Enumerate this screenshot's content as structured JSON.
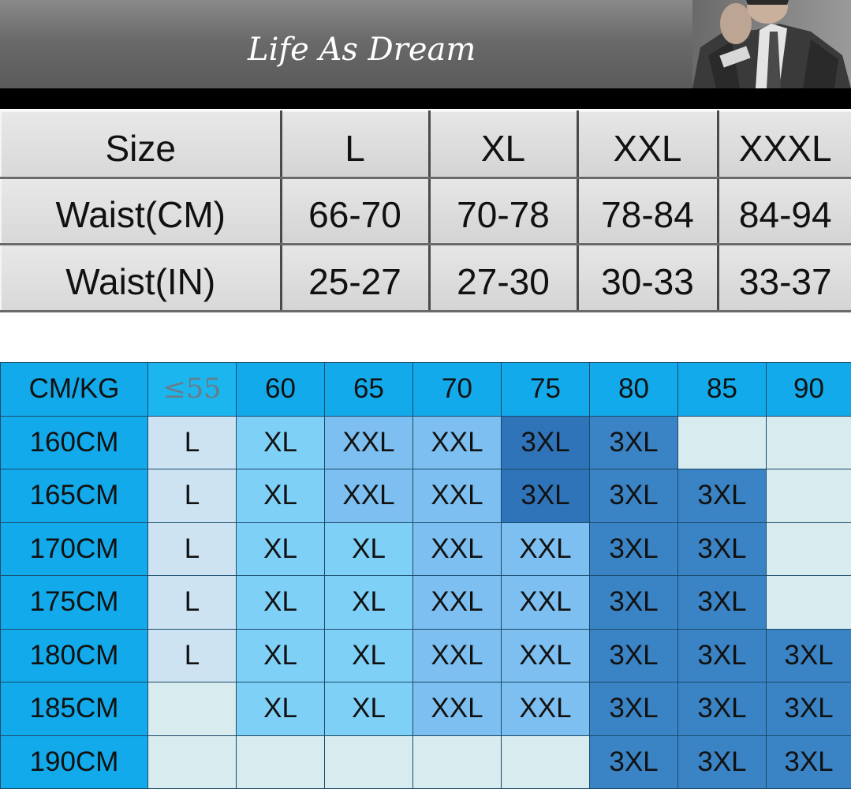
{
  "header": {
    "brand": "Life As Dream",
    "photo_icon": "model-portrait-photo"
  },
  "size_table": {
    "columns": [
      "Size",
      "L",
      "XL",
      "XXL",
      "XXXL"
    ],
    "rows": [
      {
        "label": "Waist(CM)",
        "values": [
          "66-70",
          "70-78",
          "78-84",
          "84-94"
        ]
      },
      {
        "label": "Waist(IN)",
        "values": [
          "25-27",
          "27-30",
          "30-33",
          "33-37"
        ]
      }
    ]
  },
  "fit_table": {
    "corner": "CM/KG",
    "weights": [
      "≤55",
      "60",
      "65",
      "70",
      "75",
      "80",
      "85",
      "90"
    ],
    "rows": [
      {
        "height": "160CM",
        "sizes": [
          "L",
          "XL",
          "XXL",
          "XXL",
          "3XL",
          "3XL",
          "",
          ""
        ]
      },
      {
        "height": "165CM",
        "sizes": [
          "L",
          "XL",
          "XXL",
          "XXL",
          "3XL",
          "3XL",
          "3XL",
          ""
        ]
      },
      {
        "height": "170CM",
        "sizes": [
          "L",
          "XL",
          "XL",
          "XXL",
          "XXL",
          "3XL",
          "3XL",
          ""
        ]
      },
      {
        "height": "175CM",
        "sizes": [
          "L",
          "XL",
          "XL",
          "XXL",
          "XXL",
          "3XL",
          "3XL",
          ""
        ]
      },
      {
        "height": "180CM",
        "sizes": [
          "L",
          "XL",
          "XL",
          "XXL",
          "XXL",
          "3XL",
          "3XL",
          "3XL"
        ]
      },
      {
        "height": "185CM",
        "sizes": [
          "",
          "XL",
          "XL",
          "XXL",
          "XXL",
          "3XL",
          "3XL",
          "3XL"
        ]
      },
      {
        "height": "190CM",
        "sizes": [
          "",
          "",
          "",
          "",
          "",
          "3XL",
          "3XL",
          "3XL"
        ]
      }
    ],
    "colors": {
      "header_blue": "#12aaea",
      "L": "#cde3f2",
      "XL": "#7fd0f7",
      "XXL": "#7dbff0",
      "3XL": "#3a83c4",
      "empty": "#d8ebee"
    }
  }
}
